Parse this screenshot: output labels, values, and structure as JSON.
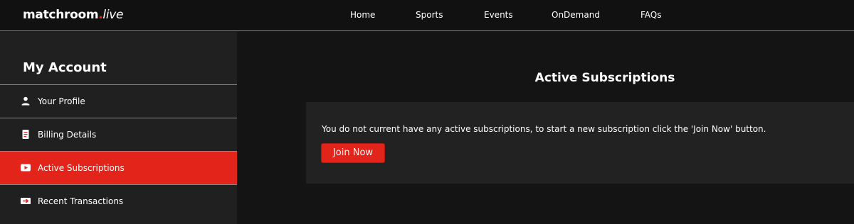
{
  "brand": {
    "name": "matchroom",
    "dot": ".",
    "suffix": "live"
  },
  "nav": [
    {
      "label": "Home"
    },
    {
      "label": "Sports"
    },
    {
      "label": "Events"
    },
    {
      "label": "OnDemand"
    },
    {
      "label": "FAQs"
    }
  ],
  "sidebar": {
    "title": "My Account",
    "items": [
      {
        "label": "Your Profile",
        "icon": "user-icon",
        "active": false
      },
      {
        "label": "Billing Details",
        "icon": "document-icon",
        "active": false
      },
      {
        "label": "Active Subscriptions",
        "icon": "play-icon",
        "active": true
      },
      {
        "label": "Recent Transactions",
        "icon": "transfer-icon",
        "active": false
      }
    ]
  },
  "main": {
    "title": "Active Subscriptions",
    "message": "You do not current have any active subscriptions, to start a new subscription click the 'Join Now' button.",
    "button_label": "Join Now"
  },
  "colors": {
    "accent": "#e3241b",
    "background": "#141414",
    "sidebar": "#202020",
    "panel": "#222222"
  }
}
